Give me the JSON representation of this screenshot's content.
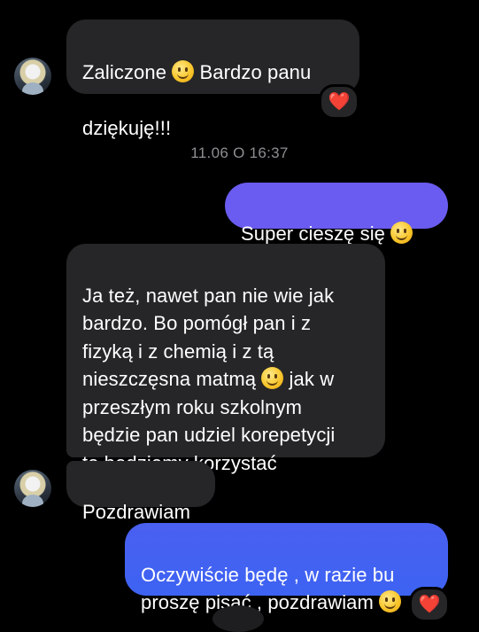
{
  "colors": {
    "background": "#000000",
    "incoming_bubble": "#262628",
    "outgoing_gradient_top": "#6a5cf0",
    "outgoing_gradient_bottom": "#3d63f2",
    "timestamp": "#8e8e93",
    "reaction_heart": "#e0253a"
  },
  "messages": [
    {
      "id": "m1",
      "direction": "incoming",
      "line1": "Zaliczone",
      "line1_after_emoji": " Bardzo panu",
      "line2": "dziękuję!!!",
      "emoji": "slightly-smiling-face-icon",
      "reaction": "❤️"
    },
    {
      "id": "m2",
      "direction": "outgoing",
      "text": "Super cieszę się",
      "emoji": "smiling-face-icon"
    },
    {
      "id": "m3",
      "direction": "incoming",
      "part1": "Ja też, nawet pan nie wie jak\nbardzo. Bo pomógł pan i z\nfizyką i z chemią i z tą\nnieszczęsna matmą",
      "part2": " jak w\nprzeszłym roku szkolnym\nbędzie pan udziel korepetycji\nto będziemy korzystać",
      "emoji": "slightly-smiling-face-icon"
    },
    {
      "id": "m4",
      "direction": "incoming",
      "text": "Pozdrawiam"
    },
    {
      "id": "m5",
      "direction": "outgoing",
      "text": "Oczywiście będę , w razie bu\nproszę pisać , pozdrawiam",
      "emoji": "smiling-face-icon",
      "reaction": "❤️"
    }
  ],
  "timestamp": "11.06 O 16:37"
}
